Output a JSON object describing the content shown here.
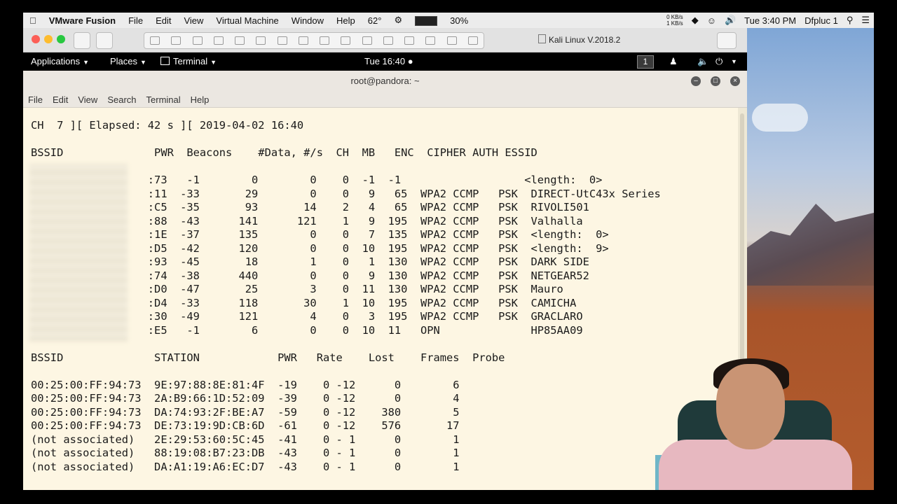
{
  "mac_menubar": {
    "apple": "",
    "app": "VMware Fusion",
    "items": [
      "File",
      "Edit",
      "View",
      "Virtual Machine",
      "Window",
      "Help"
    ],
    "temp": "62°",
    "battery": "30%",
    "net_up": "0 KB/s",
    "net_down": "1 KB/s",
    "clock": "Tue 3:40 PM",
    "user": "Dfpluc 1"
  },
  "vm": {
    "title": "Kali Linux V.2018.2"
  },
  "kali_panel": {
    "applications": "Applications",
    "places": "Places",
    "terminal": "Terminal",
    "clock": "Tue 16:40",
    "workspace": "1"
  },
  "terminal": {
    "title": "root@pandora: ~",
    "menu": [
      "File",
      "Edit",
      "View",
      "Search",
      "Terminal",
      "Help"
    ],
    "lines": [
      "CH  7 ][ Elapsed: 42 s ][ 2019-04-02 16:40",
      "",
      "BSSID              PWR  Beacons    #Data, #/s  CH  MB   ENC  CIPHER AUTH ESSID",
      "",
      "                  :73   -1        0        0    0  -1  -1                   <length:  0>",
      "                  :11  -33       29        0    0   9   65  WPA2 CCMP   PSK  DIRECT-UtC43x Series",
      "                  :C5  -35       93       14    2   4   65  WPA2 CCMP   PSK  RIVOLI501",
      "                  :88  -43      141      121    1   9  195  WPA2 CCMP   PSK  Valhalla",
      "                  :1E  -37      135        0    0   7  135  WPA2 CCMP   PSK  <length:  0>",
      "                  :D5  -42      120        0    0  10  195  WPA2 CCMP   PSK  <length:  9>",
      "                  :93  -45       18        1    0   1  130  WPA2 CCMP   PSK  DARK SIDE",
      "                  :74  -38      440        0    0   9  130  WPA2 CCMP   PSK  NETGEAR52",
      "                  :D0  -47       25        3    0  11  130  WPA2 CCMP   PSK  Mauro",
      "                  :D4  -33      118       30    1  10  195  WPA2 CCMP   PSK  CAMICHA",
      "                  :30  -49      121        4    0   3  195  WPA2 CCMP   PSK  GRACLARO",
      "                  :E5   -1        6        0    0  10  11   OPN              HP85AA09",
      "",
      "BSSID              STATION            PWR   Rate    Lost    Frames  Probe",
      "",
      "00:25:00:FF:94:73  9E:97:88:8E:81:4F  -19    0 -12      0        6",
      "00:25:00:FF:94:73  2A:B9:66:1D:52:09  -39    0 -12      0        4",
      "00:25:00:FF:94:73  DA:74:93:2F:BE:A7  -59    0 -12    380        5",
      "00:25:00:FF:94:73  DE:73:19:9D:CB:6D  -61    0 -12    576       17",
      "(not associated)   2E:29:53:60:5C:45  -41    0 - 1      0        1",
      "(not associated)   88:19:08:B7:23:DB  -43    0 - 1      0        1",
      "(not associated)   DA:A1:19:A6:EC:D7  -43    0 - 1      0        1"
    ]
  }
}
